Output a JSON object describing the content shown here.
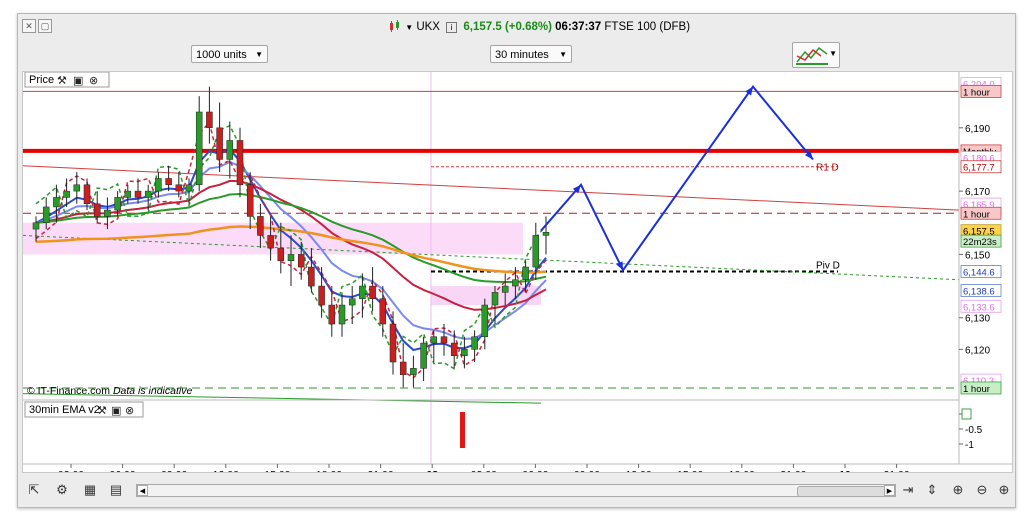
{
  "header": {
    "symbol": "UKX",
    "price": "6,157.5",
    "change": "(+0.68%)",
    "time": "06:37:37",
    "instrument": "FTSE 100 (DFB)"
  },
  "controls": {
    "size": "1000 units",
    "interval": "30 minutes"
  },
  "panels": {
    "price_label": "Price",
    "indicator_label": "30min EMA v2",
    "copyright": "© IT-Finance.com",
    "disclaimer": "Data is indicative"
  },
  "price_axis": {
    "ticks": [
      {
        "label": "6,190",
        "value": 6190
      },
      {
        "label": "6,170",
        "value": 6170
      },
      {
        "label": "6,150",
        "value": 6150
      },
      {
        "label": "6,130",
        "value": 6130
      },
      {
        "label": "6,120",
        "value": 6120
      }
    ],
    "tags": [
      {
        "label": "6,204.0",
        "value": 6204.0,
        "bg": "#ffffff",
        "fg": "#e070e0",
        "border": "#e8a0e8"
      },
      {
        "label": "1 hour",
        "value": 6201.5,
        "bg": "#f8c8c8",
        "fg": "#000000",
        "border": "#d04040"
      },
      {
        "label": "Monthly",
        "value": 6182.7,
        "bg": "#f8c8c8",
        "fg": "#000000",
        "border": "#d04040"
      },
      {
        "label": "6,180.6",
        "value": 6180.6,
        "bg": "#ffffff",
        "fg": "#e070e0",
        "border": "#e8a0e8"
      },
      {
        "label": "6,177.7",
        "value": 6177.7,
        "bg": "#ffffff",
        "fg": "#c00000",
        "border": "#d04040"
      },
      {
        "label": "6,165.9",
        "value": 6165.9,
        "bg": "#ffffff",
        "fg": "#e070e0",
        "border": "#e8a0e8"
      },
      {
        "label": "1 hour",
        "value": 6163.0,
        "bg": "#f8c8c8",
        "fg": "#000000",
        "border": "#d04040"
      },
      {
        "label": "6,157.5",
        "value": 6157.5,
        "bg": "#ffd24d",
        "fg": "#000000",
        "border": "#c09a20"
      },
      {
        "label": "22m23s",
        "value": 6154.2,
        "bg": "#c8eec8",
        "fg": "#000000",
        "border": "#40a040"
      },
      {
        "label": "6,144.6",
        "value": 6144.6,
        "bg": "#ffffff",
        "fg": "#2040c0",
        "border": "#6080d0"
      },
      {
        "label": "6,138.6",
        "value": 6138.6,
        "bg": "#ffffff",
        "fg": "#2040c0",
        "border": "#6080d0"
      },
      {
        "label": "6,133.6",
        "value": 6133.6,
        "bg": "#ffffff",
        "fg": "#e070e0",
        "border": "#e8a0e8"
      },
      {
        "label": "6,110.3",
        "value": 6110.3,
        "bg": "#ffffff",
        "fg": "#e070e0",
        "border": "#e8a0e8"
      },
      {
        "label": "1 hour",
        "value": 6107.8,
        "bg": "#c8eec8",
        "fg": "#000000",
        "border": "#40a040"
      }
    ]
  },
  "indicator_axis": {
    "ticks": [
      {
        "label": "0",
        "value": 0
      },
      {
        "label": "-0.5",
        "value": -0.5
      },
      {
        "label": "-1",
        "value": -1
      }
    ]
  },
  "time_axis": {
    "ticks": [
      {
        "label": "03:00",
        "bold": false
      },
      {
        "label": "06:00",
        "bold": false
      },
      {
        "label": "09:00",
        "bold": false
      },
      {
        "label": "12:00",
        "bold": false
      },
      {
        "label": "15:00",
        "bold": false
      },
      {
        "label": "18:00",
        "bold": false
      },
      {
        "label": "21:00",
        "bold": false
      },
      {
        "label": "08",
        "bold": true
      },
      {
        "label": "03:00",
        "bold": false
      },
      {
        "label": "06:00",
        "bold": false
      },
      {
        "label": "09:00",
        "bold": false
      },
      {
        "label": "12:00",
        "bold": false
      },
      {
        "label": "15:00",
        "bold": false
      },
      {
        "label": "18:00",
        "bold": false
      },
      {
        "label": "21:00",
        "bold": false
      },
      {
        "label": "10",
        "bold": true
      },
      {
        "label": "21:00",
        "bold": false
      }
    ]
  },
  "annotations": {
    "r1": "R1 D",
    "piv": "Piv D"
  },
  "chart_data": {
    "type": "candlestick",
    "ylim": [
      6104,
      6207
    ],
    "candles": [
      [
        6158,
        6162,
        6154,
        6160
      ],
      [
        6160,
        6168,
        6158,
        6165
      ],
      [
        6165,
        6172,
        6160,
        6168
      ],
      [
        6168,
        6174,
        6165,
        6170
      ],
      [
        6170,
        6176,
        6166,
        6172
      ],
      [
        6172,
        6174,
        6164,
        6166
      ],
      [
        6166,
        6170,
        6160,
        6162
      ],
      [
        6162,
        6168,
        6158,
        6164
      ],
      [
        6164,
        6170,
        6162,
        6168
      ],
      [
        6168,
        6172,
        6166,
        6170
      ],
      [
        6170,
        6174,
        6166,
        6168
      ],
      [
        6168,
        6172,
        6164,
        6170
      ],
      [
        6170,
        6176,
        6168,
        6174
      ],
      [
        6174,
        6178,
        6170,
        6172
      ],
      [
        6172,
        6176,
        6168,
        6170
      ],
      [
        6170,
        6174,
        6166,
        6172
      ],
      [
        6172,
        6200,
        6170,
        6195
      ],
      [
        6195,
        6203,
        6185,
        6190
      ],
      [
        6190,
        6198,
        6176,
        6180
      ],
      [
        6180,
        6192,
        6174,
        6186
      ],
      [
        6186,
        6190,
        6168,
        6172
      ],
      [
        6172,
        6176,
        6158,
        6162
      ],
      [
        6162,
        6166,
        6152,
        6156
      ],
      [
        6156,
        6162,
        6148,
        6152
      ],
      [
        6152,
        6160,
        6144,
        6148
      ],
      [
        6148,
        6156,
        6140,
        6150
      ],
      [
        6150,
        6154,
        6142,
        6146
      ],
      [
        6146,
        6152,
        6138,
        6140
      ],
      [
        6140,
        6146,
        6130,
        6134
      ],
      [
        6134,
        6140,
        6124,
        6128
      ],
      [
        6128,
        6138,
        6124,
        6134
      ],
      [
        6134,
        6140,
        6128,
        6136
      ],
      [
        6136,
        6144,
        6130,
        6140
      ],
      [
        6140,
        6146,
        6132,
        6136
      ],
      [
        6136,
        6140,
        6124,
        6128
      ],
      [
        6128,
        6132,
        6112,
        6116
      ],
      [
        6116,
        6122,
        6108,
        6112
      ],
      [
        6112,
        6118,
        6108,
        6114
      ],
      [
        6114,
        6124,
        6110,
        6122
      ],
      [
        6122,
        6126,
        6116,
        6124
      ],
      [
        6124,
        6128,
        6118,
        6122
      ],
      [
        6122,
        6126,
        6114,
        6118
      ],
      [
        6118,
        6124,
        6114,
        6120
      ],
      [
        6120,
        6126,
        6116,
        6124
      ],
      [
        6124,
        6136,
        6120,
        6134
      ],
      [
        6134,
        6140,
        6128,
        6138
      ],
      [
        6138,
        6144,
        6134,
        6140
      ],
      [
        6140,
        6146,
        6136,
        6142
      ],
      [
        6142,
        6148,
        6138,
        6146
      ],
      [
        6146,
        6160,
        6142,
        6156
      ],
      [
        6156,
        6162,
        6150,
        6157
      ]
    ]
  }
}
